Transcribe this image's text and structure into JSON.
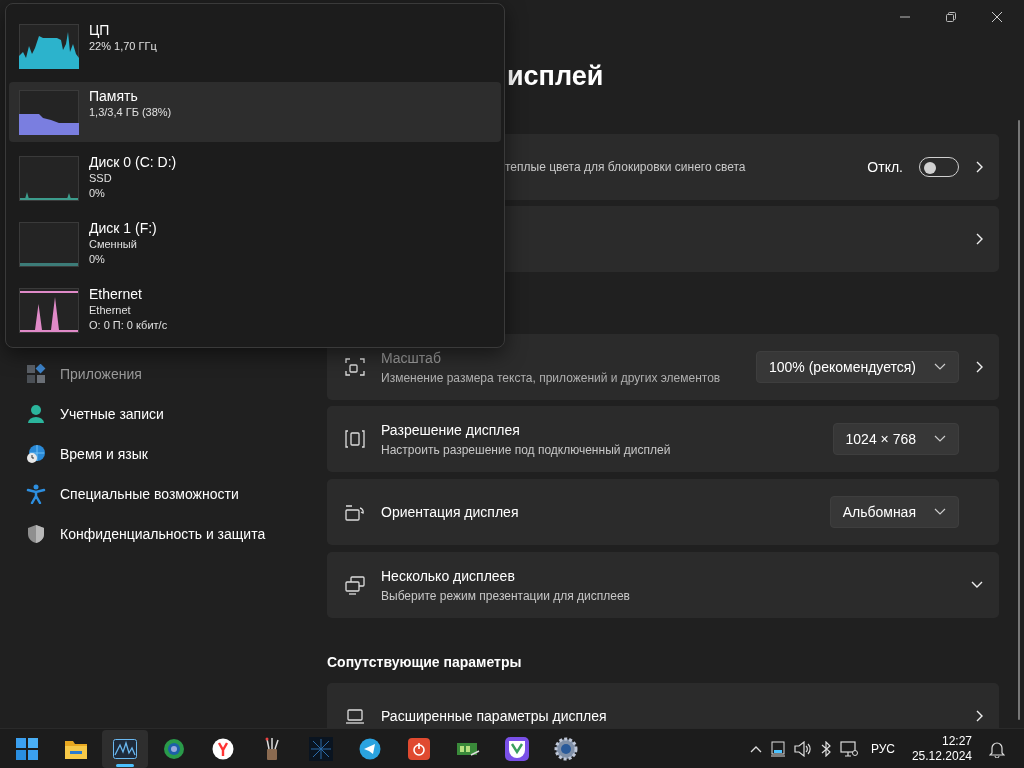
{
  "window": {
    "title": "исплей"
  },
  "sidebar": {
    "items": [
      {
        "kind": "apps",
        "label": "Приложения",
        "dimmed": true
      },
      {
        "kind": "accounts",
        "label": "Учетные записи",
        "dimmed": false
      },
      {
        "kind": "time",
        "label": "Время и язык",
        "dimmed": false
      },
      {
        "kind": "accessibility",
        "label": "Специальные возможности",
        "dimmed": false
      },
      {
        "kind": "privacy",
        "label": "Конфиденциальность и защита",
        "dimmed": false
      }
    ]
  },
  "settings_top": [
    {
      "subtitle": "теплые цвета для блокировки синего света",
      "toggle": {
        "label": "Откл.",
        "on": false
      },
      "link": true
    },
    {
      "link": true
    }
  ],
  "settings": [
    {
      "kind": "scale",
      "title": "Масштаб",
      "subtitle": "Изменение размера текста, приложений и других элементов",
      "dimmed": true,
      "dropdown": "100% (рекомендуется)",
      "link": true
    },
    {
      "kind": "resolution",
      "title": "Разрешение дисплея",
      "subtitle": "Настроить разрешение под подключенный дисплей",
      "dimmed": false,
      "dropdown": "1024 × 768"
    },
    {
      "kind": "orientation",
      "title": "Ориентация дисплея",
      "dimmed": false,
      "dropdown": "Альбомная"
    },
    {
      "kind": "multi",
      "title": "Несколько дисплеев",
      "subtitle": "Выберите режим презентации для дисплеев",
      "dimmed": false,
      "expanded": false
    }
  ],
  "related": {
    "heading": "Сопутствующие параметры",
    "items": [
      {
        "kind": "laptop",
        "title": "Расширенные параметры дисплея",
        "dimmed": false,
        "link": true
      }
    ]
  },
  "performance_popup": {
    "items": [
      {
        "kind": "cpu",
        "name": "ЦП",
        "lines": [
          "22% 1,70 ГГц"
        ],
        "color": "#2cb3cc",
        "selected": false
      },
      {
        "kind": "memory",
        "name": "Память",
        "lines": [
          "1,3/3,4 ГБ (38%)"
        ],
        "color": "#7a7ee0",
        "selected": true
      },
      {
        "kind": "disk",
        "name": "Диск 0 (C: D:)",
        "lines": [
          "SSD",
          "0%"
        ],
        "color": "#3c9c8c",
        "selected": false
      },
      {
        "kind": "disk-idle",
        "name": "Диск 1 (F:)",
        "lines": [
          "Сменный",
          "0%"
        ],
        "color": "#3c7c78",
        "selected": false
      },
      {
        "kind": "ethernet",
        "name": "Ethernet",
        "lines": [
          "Ethernet",
          "О: 0 П: 0 кбит/с"
        ],
        "color": "#e08ac8",
        "selected": false
      }
    ]
  },
  "taskbar": {
    "apps": [
      {
        "kind": "start",
        "selected": false
      },
      {
        "kind": "explorer",
        "selected": false
      },
      {
        "kind": "taskmgr",
        "selected": true
      },
      {
        "kind": "browser",
        "selected": false
      },
      {
        "kind": "yandex",
        "selected": false
      },
      {
        "kind": "tools",
        "selected": false
      },
      {
        "kind": "dark",
        "selected": false
      },
      {
        "kind": "telegram",
        "selected": false
      },
      {
        "kind": "power",
        "selected": false
      },
      {
        "kind": "green",
        "selected": false
      },
      {
        "kind": "vivaldi",
        "selected": false
      },
      {
        "kind": "gear",
        "selected": false
      }
    ],
    "language": "РУС",
    "time": "12:27",
    "date": "25.12.2024"
  }
}
